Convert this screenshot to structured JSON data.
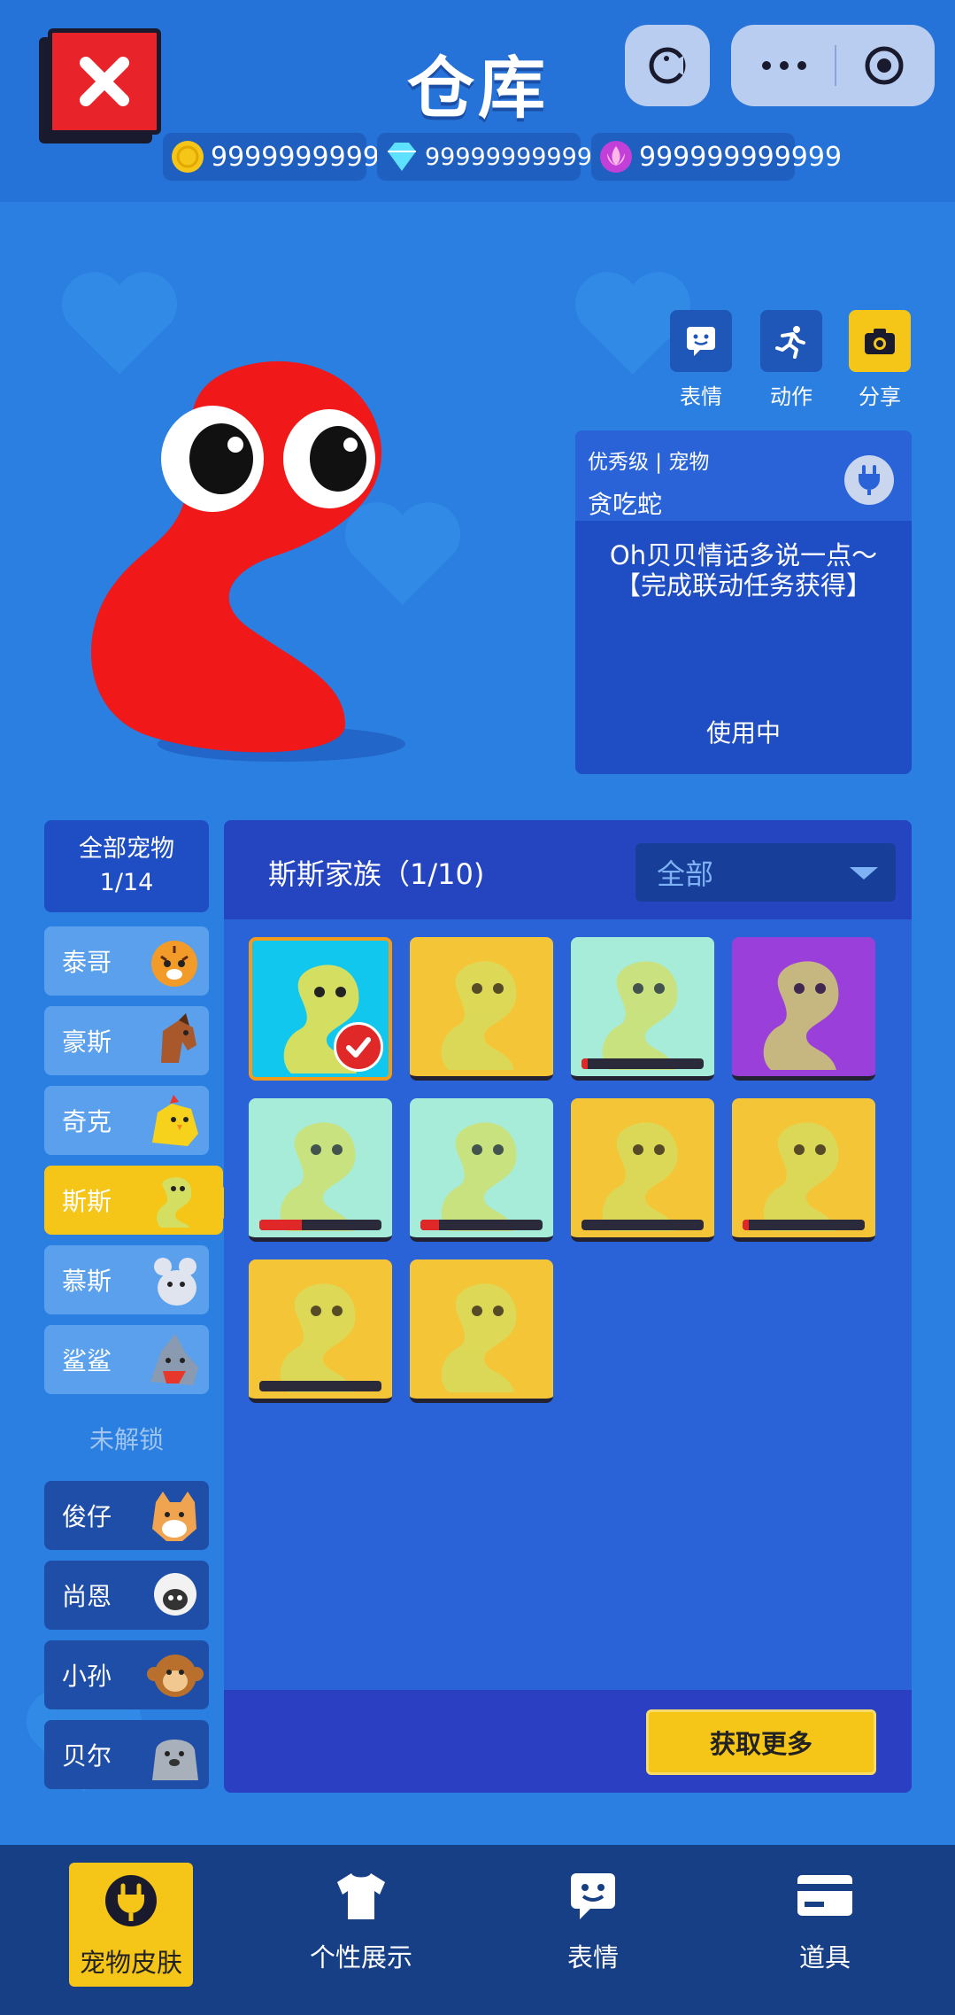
{
  "header": {
    "title": "仓库",
    "currencies": [
      {
        "icon": "coin-icon",
        "value": "999999999999"
      },
      {
        "icon": "diamond-icon",
        "value": "99999999999+"
      },
      {
        "icon": "lotus-icon",
        "value": "999999999999"
      }
    ]
  },
  "actions": [
    {
      "label": "表情",
      "icon": "emoji-icon"
    },
    {
      "label": "动作",
      "icon": "run-icon"
    },
    {
      "label": "分享",
      "icon": "camera-icon"
    }
  ],
  "pet_info": {
    "grade": "优秀级 | 宠物",
    "name": "贪吃蛇",
    "description": "Oh贝贝情话多说一点～【完成联动任务获得】",
    "status": "使用中"
  },
  "sidebar": {
    "all_label": "全部宠物",
    "all_count": "1/14",
    "unlocked": [
      {
        "label": "泰哥",
        "thumb": "tiger"
      },
      {
        "label": "豪斯",
        "thumb": "horse"
      },
      {
        "label": "奇克",
        "thumb": "chick"
      },
      {
        "label": "斯斯",
        "thumb": "snake",
        "active": true
      },
      {
        "label": "慕斯",
        "thumb": "mouse"
      },
      {
        "label": "鲨鲨",
        "thumb": "shark"
      }
    ],
    "locked_label": "未解锁",
    "locked": [
      {
        "label": "俊仔",
        "thumb": "shiba"
      },
      {
        "label": "尚恩",
        "thumb": "sheep"
      },
      {
        "label": "小孙",
        "thumb": "monkey"
      },
      {
        "label": "贝尔",
        "thumb": "seal"
      }
    ]
  },
  "panel": {
    "title": "斯斯家族（1/10)",
    "filter": "全部",
    "get_more": "获取更多",
    "skins": [
      {
        "bg": "#12c7ee",
        "selected": true,
        "progress": null
      },
      {
        "bg": "#f5c538",
        "progress": null
      },
      {
        "bg": "#a6ecd8",
        "progress": 0.05
      },
      {
        "bg": "#9a3fd9",
        "progress": null
      },
      {
        "bg": "#a6ecd8",
        "progress": 0.35
      },
      {
        "bg": "#a6ecd8",
        "progress": 0.15
      },
      {
        "bg": "#f5c538",
        "progress": 0.0
      },
      {
        "bg": "#f5c538",
        "progress": 0.05
      },
      {
        "bg": "#f5c538",
        "progress": 0.0
      },
      {
        "bg": "#f5c538",
        "progress": null
      }
    ]
  },
  "bottom_nav": [
    {
      "label": "宠物皮肤",
      "icon": "plug-icon",
      "active": true
    },
    {
      "label": "个性展示",
      "icon": "shirt-icon"
    },
    {
      "label": "表情",
      "icon": "chat-emoji-icon"
    },
    {
      "label": "道具",
      "icon": "card-icon"
    }
  ]
}
